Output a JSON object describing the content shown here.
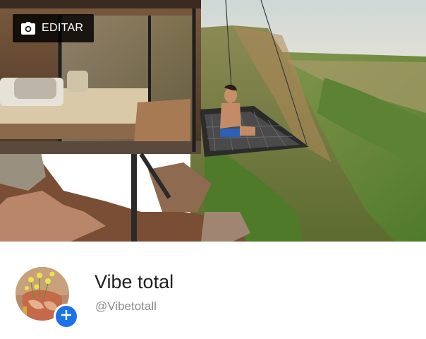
{
  "cover": {
    "edit_label": "EDITAR",
    "edit_icon": "camera-icon"
  },
  "profile": {
    "name": "Vibe total",
    "handle": "@Vibetotall",
    "add_icon": "plus-icon",
    "accent_color": "#1a73e8"
  }
}
